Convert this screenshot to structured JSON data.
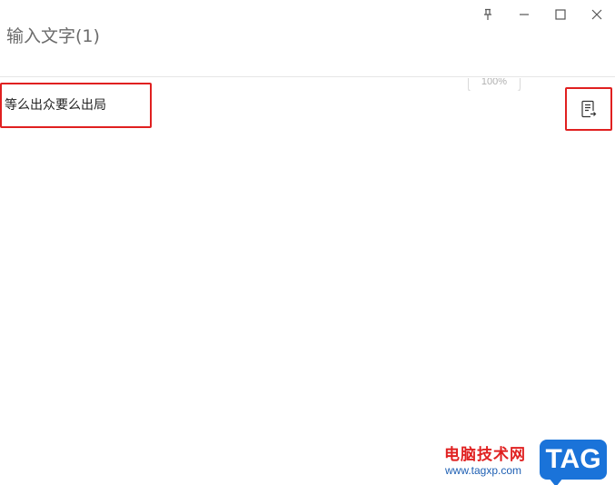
{
  "window": {
    "title": "输入文字(1)",
    "controls": {
      "pin_icon": "pin-icon",
      "minimize_icon": "minimize-icon",
      "maximize_icon": "maximize-icon",
      "close_icon": "close-icon"
    }
  },
  "zoom": {
    "label": "100%"
  },
  "result": {
    "text": "等么出众要么出局",
    "action_icon": "export-document-icon"
  },
  "watermark": {
    "site_name": "电脑技术网",
    "url": "www.tagxp.com",
    "badge": "TAG"
  },
  "colors": {
    "highlight": "#e02020",
    "badge": "#1a73d9",
    "title_text": "#6b6b6b"
  }
}
